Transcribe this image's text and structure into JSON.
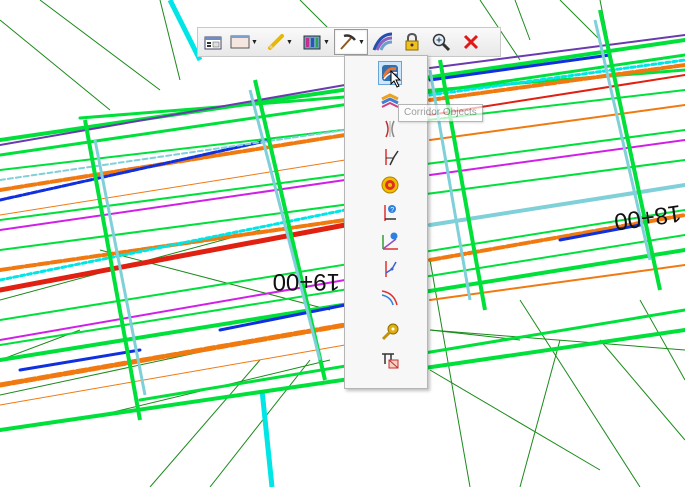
{
  "stations": {
    "left": "19+00",
    "right": "18+00"
  },
  "toolbar": {
    "buttons": [
      {
        "icon": "element-properties-icon",
        "has_menu": false
      },
      {
        "icon": "view-window-icon",
        "has_menu": true
      },
      {
        "icon": "pencil-icon",
        "has_menu": true
      },
      {
        "icon": "corridor-icon",
        "has_menu": true
      },
      {
        "icon": "pickaxe-icon",
        "has_menu": true,
        "pressed": true
      },
      {
        "icon": "road-section-icon",
        "has_menu": false
      },
      {
        "icon": "lock-icon",
        "has_menu": false
      },
      {
        "icon": "zoom-icon",
        "has_menu": false
      },
      {
        "icon": "close-icon",
        "has_menu": false
      }
    ]
  },
  "flyout": {
    "items": [
      "corridor-objects-icon",
      "superelevation-icon",
      "transition-icon",
      "profile-break-icon",
      "target-icon",
      "point-control-icon",
      "slope-control-icon",
      "vertical-control-icon",
      "curve-widening-icon",
      "key-station-icon",
      "end-condition-icon"
    ],
    "tooltip": "Corridor Objects"
  },
  "colors": {
    "green": "#00e03a",
    "dark_green": "#1a8a1a",
    "cyan": "#00e5e5",
    "light_cyan": "#7fd0d8",
    "blue": "#1030e0",
    "red": "#e02010",
    "magenta": "#d020e8",
    "orange": "#f07a10",
    "purple": "#6a3ab0"
  }
}
